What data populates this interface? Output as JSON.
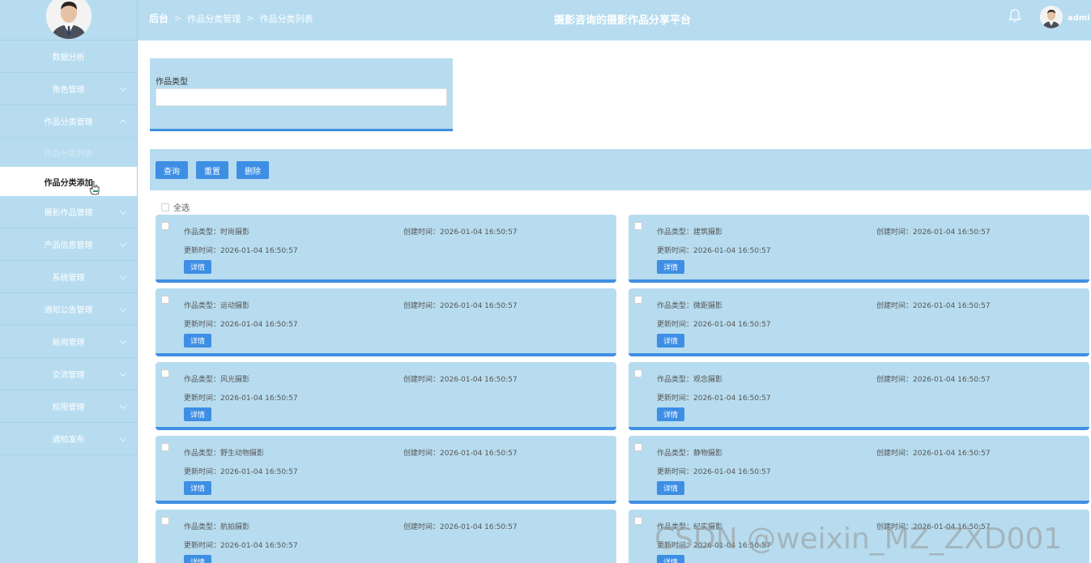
{
  "header": {
    "breadcrumb": [
      "后台",
      "作品分类管理",
      "作品分类列表"
    ],
    "site_title": "摄影咨询的摄影作品分享平台",
    "user_name": "admi"
  },
  "sidebar": {
    "items": [
      {
        "label": "数据分析",
        "chevron": false
      },
      {
        "label": "角色管理",
        "chevron": true
      },
      {
        "label": "作品分类管理",
        "chevron": true,
        "expanded": true
      },
      {
        "label": "摄影作品管理",
        "chevron": true
      },
      {
        "label": "产品信息管理",
        "chevron": true
      },
      {
        "label": "系统管理",
        "chevron": true
      },
      {
        "label": "通知公告管理",
        "chevron": true
      },
      {
        "label": "新闻管理",
        "chevron": true
      },
      {
        "label": "交流管理",
        "chevron": true
      },
      {
        "label": "权限管理",
        "chevron": true
      },
      {
        "label": "通知发布",
        "chevron": true
      }
    ],
    "submenu": [
      {
        "label": "作品分类列表",
        "active": false
      },
      {
        "label": "作品分类添加",
        "active": true
      }
    ]
  },
  "search": {
    "label": "作品类型",
    "value": "",
    "placeholder": ""
  },
  "actions": {
    "query": "查询",
    "reset": "重置",
    "delete": "删除"
  },
  "select_all_label": "全选",
  "card_labels": {
    "type_prefix": "作品类型：",
    "created_prefix": "创建时间：",
    "updated_prefix": "更新时间：",
    "detail_button": "详情"
  },
  "cards": [
    {
      "type": "时尚摄影",
      "created": "2026-01-04 16:50:57",
      "updated": "2026-01-04 16:50:57"
    },
    {
      "type": "建筑摄影",
      "created": "2026-01-04 16:50:57",
      "updated": "2026-01-04 16:50:57"
    },
    {
      "type": "运动摄影",
      "created": "2026-01-04 16:50:57",
      "updated": "2026-01-04 16:50:57"
    },
    {
      "type": "微距摄影",
      "created": "2026-01-04 16:50:57",
      "updated": "2026-01-04 16:50:57"
    },
    {
      "type": "风光摄影",
      "created": "2026-01-04 16:50:57",
      "updated": "2026-01-04 16:50:57"
    },
    {
      "type": "观念摄影",
      "created": "2026-01-04 16:50:57",
      "updated": "2026-01-04 16:50:57"
    },
    {
      "type": "野生动物摄影",
      "created": "2026-01-04 16:50:57",
      "updated": "2026-01-04 16:50:57"
    },
    {
      "type": "静物摄影",
      "created": "2026-01-04 16:50:57",
      "updated": "2026-01-04 16:50:57"
    },
    {
      "type": "航拍摄影",
      "created": "2026-01-04 16:50:57",
      "updated": "2026-01-04 16:50:57"
    },
    {
      "type": "纪实摄影",
      "created": "2026-01-04 16:50:57",
      "updated": "2026-01-04 16:50:57"
    }
  ],
  "watermark": "CSDN @weixin_MZ_ZXD001",
  "colors": {
    "panel": "#b7dcef",
    "accent": "#3e8ee4"
  }
}
